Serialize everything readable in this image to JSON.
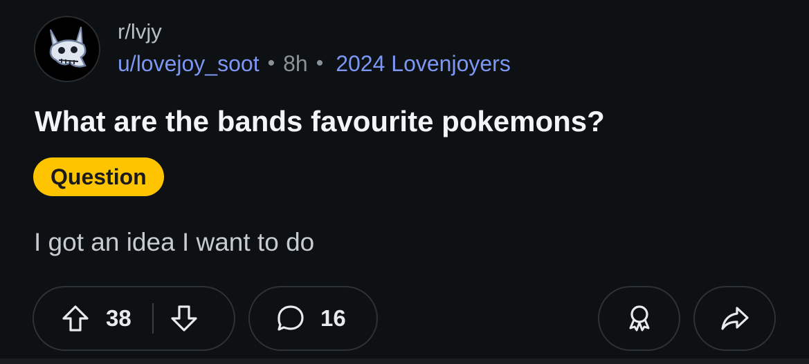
{
  "header": {
    "subreddit": "r/lvjy",
    "username": "u/lovejoy_soot",
    "separator": "•",
    "age": "8h",
    "user_flair": "2024 Lovenjoyers"
  },
  "post": {
    "title": "What are the bands favourite pokemons?",
    "flair": "Question",
    "body": "I got an idea I want to do"
  },
  "actions": {
    "upvotes": "38",
    "comments": "16"
  },
  "icons": {
    "avatar": "fox-skull-avatar",
    "upvote": "arrow-up-icon",
    "downvote": "arrow-down-icon",
    "comment": "speech-bubble-icon",
    "award": "award-ribbon-icon",
    "share": "share-arrow-icon"
  },
  "colors": {
    "background": "#0e1113",
    "link_blue": "#7c97f5",
    "flair_yellow": "#ffc400",
    "muted_text": "#8a9299"
  }
}
